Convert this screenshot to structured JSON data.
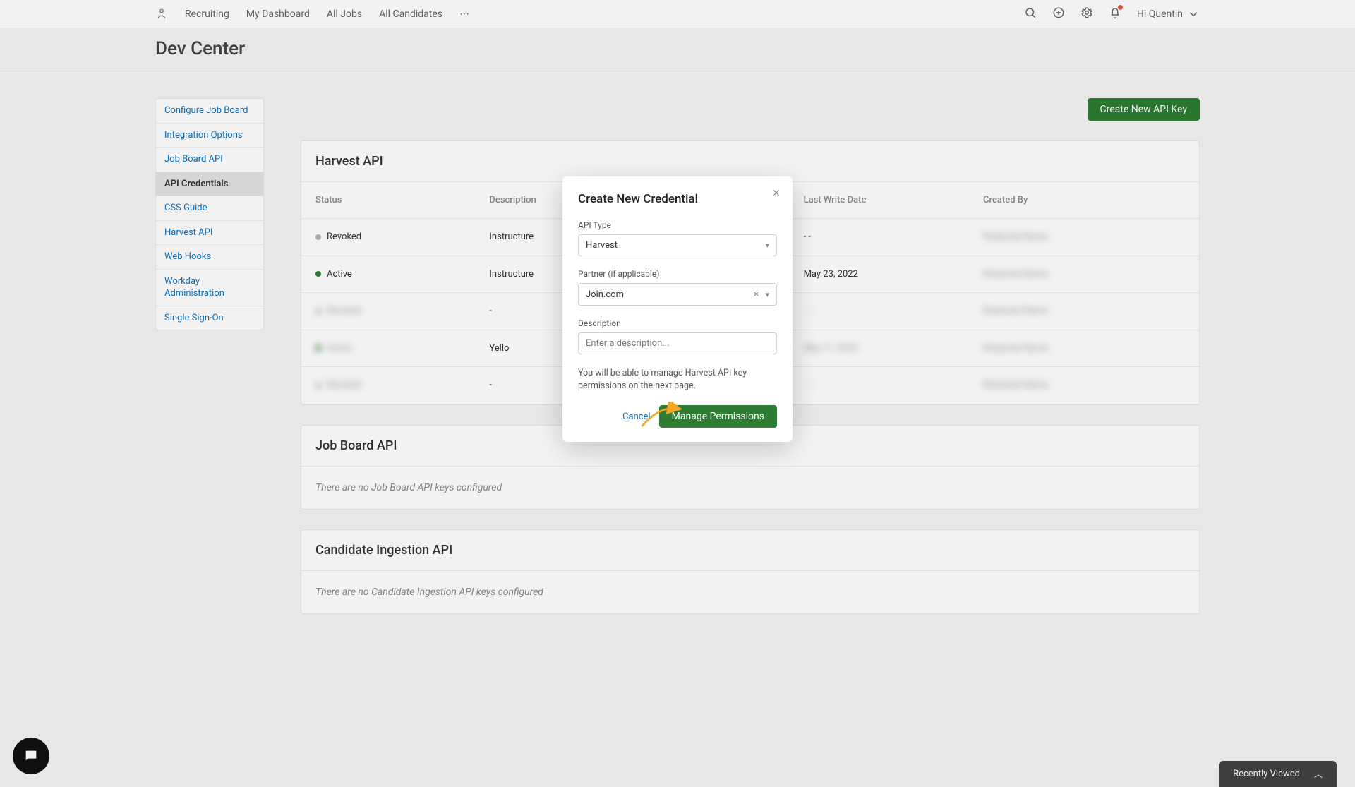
{
  "nav": {
    "brand": "Recruiting",
    "links": [
      "My Dashboard",
      "All Jobs",
      "All Candidates"
    ],
    "user_name": "Hi Quentin"
  },
  "page_title": "Dev Center",
  "sidebar": {
    "items": [
      {
        "label": "Configure Job Board"
      },
      {
        "label": "Integration Options"
      },
      {
        "label": "Job Board API"
      },
      {
        "label": "API Credentials",
        "active": true
      },
      {
        "label": "CSS Guide"
      },
      {
        "label": "Harvest API"
      },
      {
        "label": "Web Hooks"
      },
      {
        "label": "Workday Administration"
      },
      {
        "label": "Single Sign-On"
      }
    ]
  },
  "create_button": "Create New API Key",
  "sections": {
    "harvest": {
      "title": "Harvest API",
      "columns": [
        "Status",
        "Description",
        "Last Write Date",
        "Created By"
      ],
      "rows": [
        {
          "status": "Revoked",
          "dot": "grey",
          "description": "Instructure",
          "date": "- -",
          "created_by": "Redacted Name"
        },
        {
          "status": "Active",
          "dot": "green",
          "description": "Instructure",
          "date": "May 23, 2022",
          "created_by": "Redacted Name"
        },
        {
          "status": "Revoked",
          "dot": "grey",
          "description": "-",
          "date": "- -",
          "created_by": "Redacted Name",
          "blur_status": true,
          "blur_date": true
        },
        {
          "status": "Active",
          "dot": "green",
          "description": "Yello",
          "date": "May 11, 2022",
          "created_by": "Redacted Name",
          "blur_status": true,
          "blur_date": true
        },
        {
          "status": "Revoked",
          "dot": "grey",
          "description": "-",
          "date": "- -",
          "created_by": "Redacted Name",
          "blur_status": true,
          "blur_date": true
        }
      ]
    },
    "job_board": {
      "title": "Job Board API",
      "empty": "There are no Job Board API keys configured"
    },
    "ingestion": {
      "title": "Candidate Ingestion API",
      "empty": "There are no Candidate Ingestion API keys configured"
    }
  },
  "modal": {
    "title": "Create New Credential",
    "api_type_label": "API Type",
    "api_type_value": "Harvest",
    "partner_label": "Partner (if applicable)",
    "partner_value": "Join.com",
    "description_label": "Description",
    "description_placeholder": "Enter a description...",
    "hint": "You will be able to manage Harvest API key permissions on the next page.",
    "cancel": "Cancel",
    "submit": "Manage Permissions"
  },
  "viewed_tab": "Recently Viewed"
}
